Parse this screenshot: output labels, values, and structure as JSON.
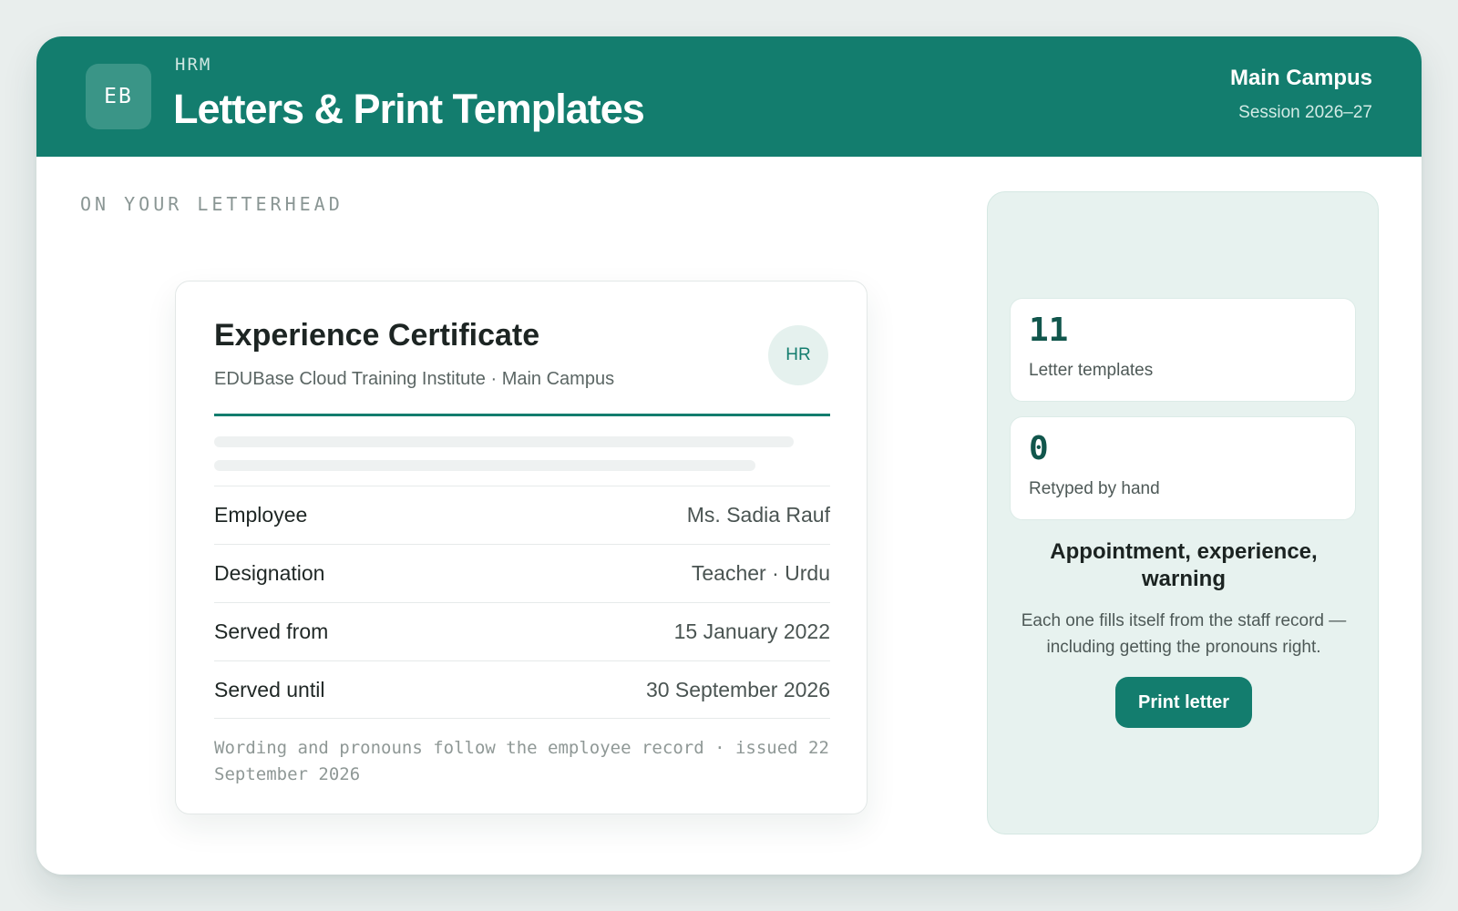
{
  "header": {
    "logo_text": "EB",
    "module": "HRM",
    "title": "Letters & Print Templates",
    "campus": "Main Campus",
    "session": "Session 2026–27"
  },
  "main": {
    "section_label": "ON YOUR LETTERHEAD",
    "certificate": {
      "title": "Experience Certificate",
      "subtitle": "EDUBase Cloud Training Institute · Main Campus",
      "badge": "HR",
      "fields": [
        {
          "label": "Employee",
          "value": "Ms. Sadia Rauf"
        },
        {
          "label": "Designation",
          "value": "Teacher · Urdu"
        },
        {
          "label": "Served from",
          "value": "15 January 2022"
        },
        {
          "label": "Served until",
          "value": "30 September 2026"
        }
      ],
      "footnote": "Wording and pronouns follow the employee record · issued 22 September 2026"
    }
  },
  "side_panel": {
    "stats": [
      {
        "value": "11",
        "label": "Letter templates"
      },
      {
        "value": "0",
        "label": "Retyped by hand"
      }
    ],
    "heading": "Appointment, experience, warning",
    "description": "Each one fills itself from the staff record — including getting the pronouns right.",
    "button_label": "Print letter"
  },
  "colors": {
    "brand": "#137d6e",
    "panel_bg": "#e7f2ef",
    "stat_value": "#11564c"
  }
}
